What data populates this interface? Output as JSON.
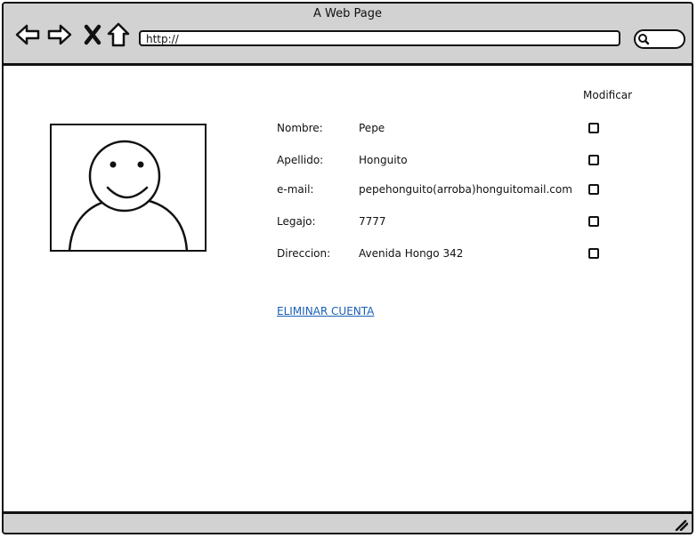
{
  "window": {
    "title": "A Web Page"
  },
  "browser": {
    "url": "http://",
    "nav_icons": [
      "back-arrow-icon",
      "forward-arrow-icon",
      "close-icon",
      "home-icon"
    ],
    "search_icon": "magnifier-icon"
  },
  "profile": {
    "avatar_icon": "smiley-face-icon",
    "modify_header": "Modificar",
    "fields": [
      {
        "label": "Nombre:",
        "value": "Pepe"
      },
      {
        "label": "Apellido:",
        "value": "Honguito"
      },
      {
        "label": "e-mail:",
        "value": "pepehonguito(arroba)honguitomail.com"
      },
      {
        "label": "Legajo:",
        "value": "7777"
      },
      {
        "label": "Direccion:",
        "value": "Avenida Hongo 342"
      }
    ],
    "delete_link": "ELIMINAR CUENTA"
  }
}
